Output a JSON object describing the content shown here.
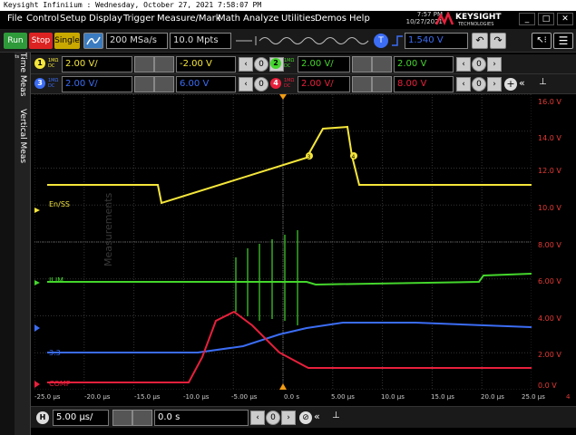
{
  "window": {
    "title": "Keysight Infiniium : Wednesday, October 27, 2021 7:58:07 PM"
  },
  "menu": [
    "File",
    "Control",
    "Setup",
    "Display",
    "Trigger",
    "Measure/Mark",
    "Math",
    "Analyze",
    "Utilities",
    "Demos",
    "Help"
  ],
  "clock": {
    "time": "7:57 PM",
    "date": "10/27/2021"
  },
  "brand": {
    "name": "KEYSIGHT",
    "sub": "TECHNOLOGIES"
  },
  "toolbar": {
    "run": "Run",
    "stop": "Stop",
    "single": "Single",
    "sample_rate": "200 MSa/s",
    "memory": "10.0 Mpts",
    "trigger_level": "1.540 V"
  },
  "channels": [
    {
      "num": "1",
      "imp": "1MΩ",
      "coupling": "DC",
      "scale": "2.00 V/",
      "offset": "-2.00 V",
      "color": "#f5e63a"
    },
    {
      "num": "2",
      "imp": "1MΩ",
      "coupling": "DC",
      "scale": "2.00 V/",
      "offset": "2.00 V",
      "color": "#44d62c"
    },
    {
      "num": "3",
      "imp": "1MΩ",
      "coupling": "DC",
      "scale": "2.00 V/",
      "offset": "6.00 V",
      "color": "#3b6df5"
    },
    {
      "num": "4",
      "imp": "1MΩ",
      "coupling": "DC",
      "scale": "2.00 V/",
      "offset": "8.00 V",
      "color": "#e8203c"
    }
  ],
  "sidebar": {
    "tab1": "Time Meas",
    "tab2": "Vertical Meas",
    "results": "Results ⌄",
    "watermark": "Measurements"
  },
  "traces": {
    "labels": [
      "En/SS",
      "ILIM",
      "3.3",
      "COMP"
    ],
    "markers": [
      "3",
      "4"
    ],
    "right_axis": [
      "16.0 V",
      "14.0 V",
      "12.0 V",
      "10.0 V",
      "8.00 V",
      "6.00 V",
      "4.00 V",
      "2.00 V",
      "0.0 V"
    ],
    "x_axis": [
      "-25.0 µs",
      "-20.0 µs",
      "-15.0 µs",
      "-10.0 µs",
      "-5.00 µs",
      "0.0 s",
      "5.00 µs",
      "10.0 µs",
      "15.0 µs",
      "20.0 µs",
      "25.0 µs"
    ],
    "x_overflow": "4"
  },
  "bottom": {
    "h_badge": "H",
    "timebase": "5.00 µs/",
    "delay": "0.0 s"
  },
  "icons": [
    "run-button",
    "stop-button",
    "single-button",
    "autoscale-icon",
    "trigger-icon",
    "undo-icon",
    "redo-icon",
    "cursor-icon",
    "menu-icon"
  ]
}
